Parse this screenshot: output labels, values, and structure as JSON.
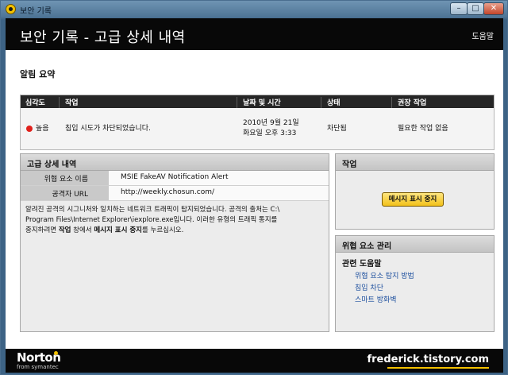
{
  "window": {
    "title": "보안 기록",
    "minimize": "–",
    "maximize": "□",
    "close": "✕"
  },
  "header": {
    "title": "보안 기록 - 고급 상세 내역",
    "help": "도움말"
  },
  "summary": {
    "title": "알림 요약",
    "columns": [
      "심각도",
      "작업",
      "날짜 및 시간",
      "상태",
      "권장 작업"
    ],
    "row": {
      "severity": "높음",
      "severity_color": "#e0201b",
      "action": "침입 시도가 차단되었습니다.",
      "datetime_line1": "2010년 9월 21일",
      "datetime_line2": "화요일 오후 3:33",
      "status": "차단됨",
      "recommended": "필요한 작업 없음"
    }
  },
  "details": {
    "title": "고급 상세 내역",
    "rows": [
      {
        "label": "위협 요소 이름",
        "value": "MSIE FakeAV Notification Alert"
      },
      {
        "label": "공격자 URL",
        "value": "http://weekly.chosun.com/"
      }
    ],
    "desc_line1": "알려진 공격의 시그니처와 일치하는 네트워크 트래픽이 탐지되었습니다. 공격의 출처는 C:\\",
    "desc_line2": "Program Files\\Internet Explorer\\iexplore.exe입니다. 이러한 유형의 트래픽 통지를",
    "desc_line3_pre": "중지하려면 ",
    "desc_line3_b1": "작업",
    "desc_line3_mid": " 창에서 ",
    "desc_line3_b2": "메시지 표시 중지",
    "desc_line3_post": "를 누르십시오."
  },
  "actions": {
    "title": "작업",
    "stop_button": "메시지 표시 중지"
  },
  "threat": {
    "title": "위협 요소 관리",
    "help_title": "관련 도움말",
    "links": [
      "위협 요소 탐지 방법",
      "침입 차단",
      "스마트 방화벽"
    ]
  },
  "footer": {
    "logo": "Norton",
    "logo_sub": "from symantec",
    "watermark": "frederick.tistory.com",
    "accent": "#f4c200"
  }
}
